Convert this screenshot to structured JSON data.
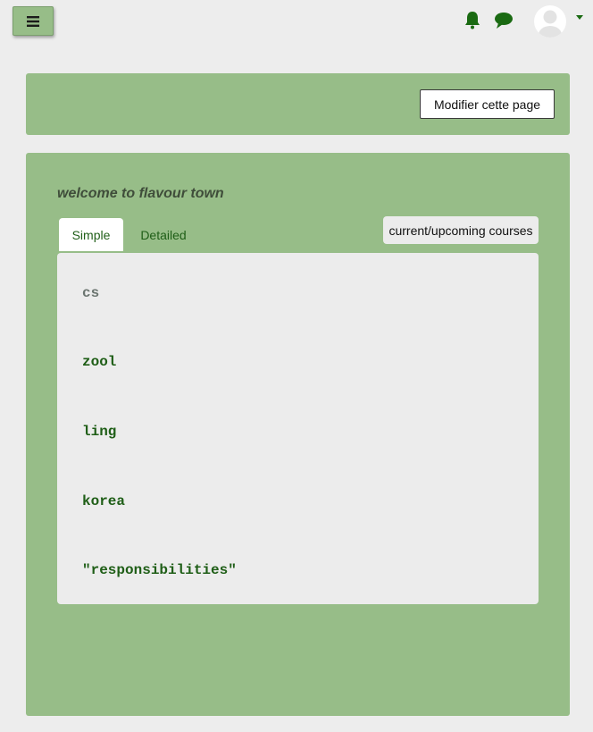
{
  "topbar": {
    "menu_icon": "hamburger-icon",
    "notification_icon": "bell-icon",
    "messages_icon": "chat-bubble-icon",
    "avatar_icon": "user-avatar-icon",
    "dropdown_icon": "caret-down-icon"
  },
  "header_panel": {
    "edit_button_label": "Modifier cette page"
  },
  "main_panel": {
    "title": "welcome to flavour town",
    "tabs": [
      {
        "label": "Simple",
        "active": true
      },
      {
        "label": "Detailed",
        "active": false
      }
    ],
    "courses_button_label": "current/upcoming courses",
    "items": [
      {
        "label": "cs"
      },
      {
        "label": "zool"
      },
      {
        "label": "ling"
      },
      {
        "label": "korea"
      },
      {
        "label": "\"responsibilities\""
      }
    ]
  },
  "colors": {
    "page_background": "#ededed",
    "panel_green": "#97bd88",
    "link_green": "#1f5e17",
    "icon_green": "#1a6a12"
  }
}
